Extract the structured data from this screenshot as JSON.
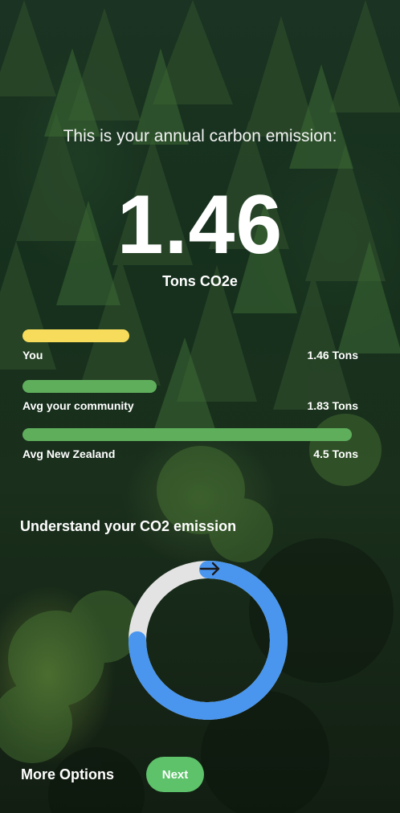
{
  "intro_text": "This is your annual carbon emission:",
  "emission_value": "1.46",
  "emission_unit": "Tons CO2e",
  "comparison": [
    {
      "label": "You",
      "value": "1.46 Tons",
      "amount": 1.46,
      "color": "#f6dc5a"
    },
    {
      "label": "Avg your community",
      "value": "1.83 Tons",
      "amount": 1.83,
      "color": "#5fae5c"
    },
    {
      "label": "Avg New Zealand",
      "value": "4.5 Tons",
      "amount": 4.5,
      "color": "#5fae5c"
    }
  ],
  "section_title": "Understand your CO2 emission",
  "ring": {
    "progress_fraction": 0.75,
    "fill_color": "#4a96ef",
    "track_color": "#e3e3e3",
    "icon": "arrow-right-icon"
  },
  "footer": {
    "more_options_label": "More Options",
    "next_label": "Next"
  },
  "colors": {
    "accent_green": "#5dc26a"
  }
}
